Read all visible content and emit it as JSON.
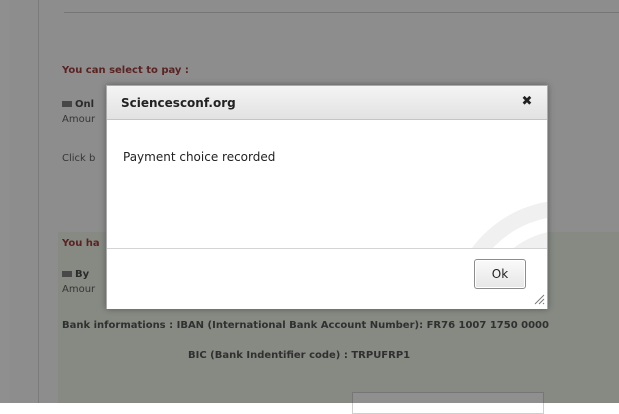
{
  "background_page": {
    "select_heading": "You can select to pay :",
    "option_online_label": "Onl",
    "option_online_amount_label": "Amour",
    "click_hint": "Click b",
    "you_have_heading": "You ha",
    "option_transfer_label": "By",
    "option_transfer_amount_label": "Amour",
    "bank_info_line": "Bank informations : IBAN (International Bank Account Number): FR76 1007 1750 0000",
    "bic_line": "BIC (Bank Indentifier code) : TRPUFRP1"
  },
  "dialog": {
    "title": "Sciencesconf.org",
    "close_glyph": "✖",
    "message": "Payment choice recorded",
    "ok_label": "Ok"
  },
  "colors": {
    "overlay": "rgba(20,20,20,0.48)",
    "green_panel": "#eef5e8",
    "heading_red": "#9b2f2f"
  }
}
